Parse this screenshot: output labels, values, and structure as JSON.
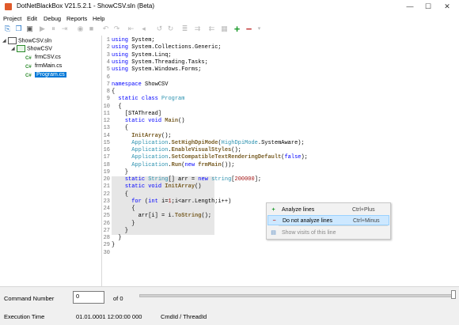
{
  "window": {
    "title": "DotNetBlackBox V21.5.2.1 - ShowCSV.sln (Beta)",
    "minimize": "—",
    "maximize": "☐",
    "close": "✕"
  },
  "menu": [
    "Project",
    "Edit",
    "Debug",
    "Reports",
    "Help"
  ],
  "tree": {
    "solution": "ShowCSV.sln",
    "project": "ShowCSV",
    "files": [
      "frmCSV.cs",
      "frmMain.cs",
      "Program.cs"
    ],
    "selected": "Program.cs"
  },
  "editor": {
    "highlighted_lines": [
      20,
      21,
      22,
      23,
      24,
      25,
      26,
      27
    ],
    "lines": [
      {
        "n": "1",
        "code": "using System;"
      },
      {
        "n": "2",
        "code": "using System.Collections.Generic;"
      },
      {
        "n": "3",
        "code": "using System.Linq;"
      },
      {
        "n": "4",
        "code": "using System.Threading.Tasks;"
      },
      {
        "n": "5",
        "code": "using System.Windows.Forms;"
      },
      {
        "n": "6",
        "code": ""
      },
      {
        "n": "7",
        "code": "namespace ShowCSV"
      },
      {
        "n": "8",
        "code": "{"
      },
      {
        "n": "9",
        "code": "  static class Program"
      },
      {
        "n": "10",
        "code": "  {"
      },
      {
        "n": "11",
        "code": "    [STAThread]"
      },
      {
        "n": "12",
        "code": "    static void Main()"
      },
      {
        "n": "13",
        "code": "    {"
      },
      {
        "n": "14",
        "code": "      InitArray();"
      },
      {
        "n": "15",
        "code": "      Application.SetHighDpiMode(HighDpiMode.SystemAware);"
      },
      {
        "n": "16",
        "code": "      Application.EnableVisualStyles();"
      },
      {
        "n": "17",
        "code": "      Application.SetCompatibleTextRenderingDefault(false);"
      },
      {
        "n": "18",
        "code": "      Application.Run(new frmMain());"
      },
      {
        "n": "19",
        "code": "    }"
      },
      {
        "n": "20",
        "code": "    static String[] arr = new string[200000];"
      },
      {
        "n": "21",
        "code": "    static void InitArray()"
      },
      {
        "n": "22",
        "code": "    {"
      },
      {
        "n": "23",
        "code": "      for (int i=1;i<arr.Length;i++)"
      },
      {
        "n": "24",
        "code": "      {"
      },
      {
        "n": "25",
        "code": "        arr[i] = i.ToString();"
      },
      {
        "n": "26",
        "code": "      }"
      },
      {
        "n": "27",
        "code": "    }"
      },
      {
        "n": "28",
        "code": "  }"
      },
      {
        "n": "29",
        "code": "}"
      },
      {
        "n": "30",
        "code": ""
      }
    ]
  },
  "context_menu": {
    "items": [
      {
        "icon": "+",
        "label": "Analyze lines",
        "shortcut": "Ctrl+Plus",
        "enabled": true
      },
      {
        "icon": "−",
        "label": "Do not analyze lines",
        "shortcut": "Ctrl+Minus",
        "enabled": true,
        "hover": true
      },
      {
        "icon": "▤",
        "label": "Show visits of this line",
        "shortcut": "",
        "enabled": false
      }
    ]
  },
  "bottom": {
    "command_number_label": "Command Number",
    "command_number_value": "0",
    "of_label": "of 0",
    "execution_time_label": "Execution Time",
    "execution_time_value": "01.01.0001 12:00:00 000",
    "cmdid_label": "CmdId / ThreadId"
  },
  "colors": {
    "keyword": "#0000ff",
    "type": "#2b91af",
    "method": "#795e26",
    "number": "#a31515",
    "highlight": "#e6e6e6",
    "selection": "#0078d7"
  }
}
